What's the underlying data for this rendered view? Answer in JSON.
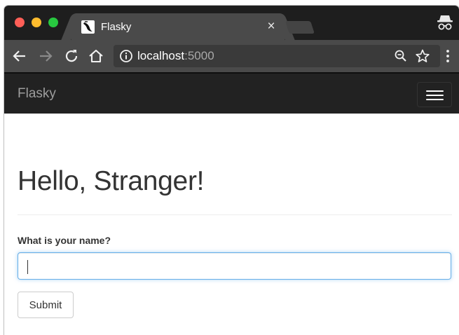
{
  "browser": {
    "tab_title": "Flasky",
    "tab_close_glyph": "×",
    "url_host": "localhost",
    "url_port": ":5000",
    "icons": [
      "back-arrow-icon",
      "forward-arrow-icon",
      "reload-icon",
      "home-icon",
      "info-icon",
      "zoom-icon",
      "star-icon",
      "menu-dots-icon",
      "incognito-icon",
      "flask-favicon-icon"
    ]
  },
  "navbar": {
    "brand": "Flasky"
  },
  "page": {
    "heading": "Hello, Stranger!",
    "form": {
      "label": "What is your name?",
      "name_value": "",
      "submit_label": "Submit"
    }
  },
  "colors": {
    "navbar_bg": "#222222",
    "brand_text": "#9d9d9d",
    "input_focus": "#66afe9",
    "text": "#333333"
  }
}
